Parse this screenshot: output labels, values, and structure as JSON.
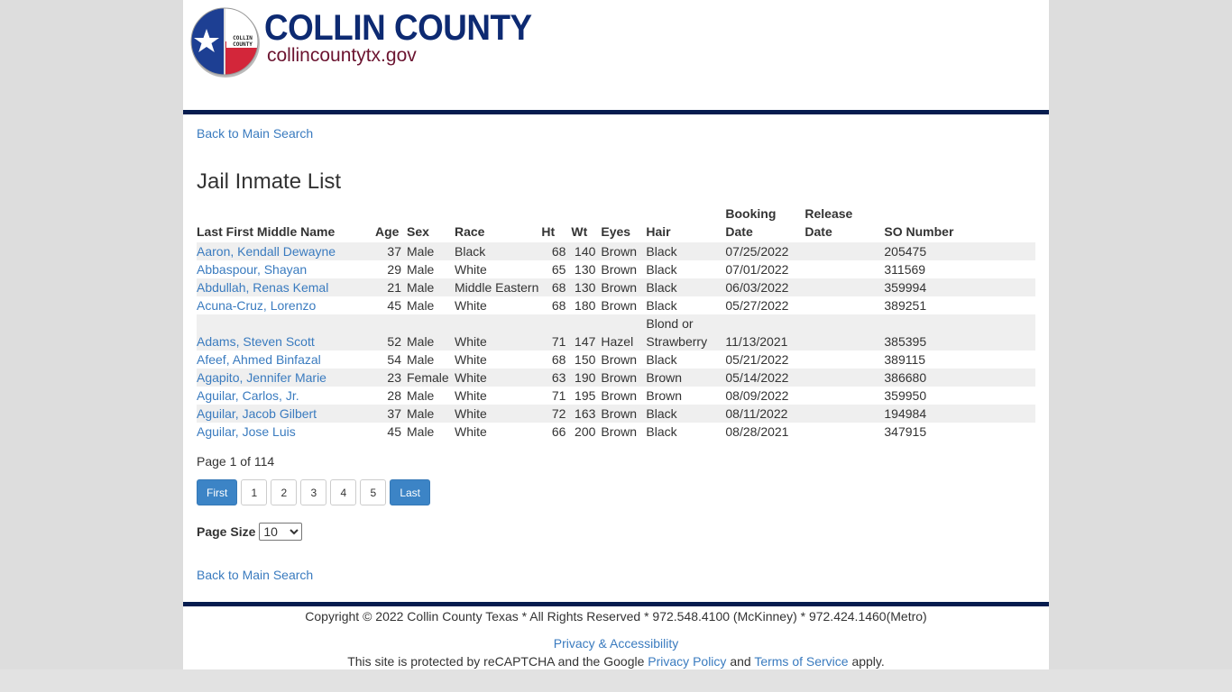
{
  "header": {
    "logo_seal_text": [
      "COLLIN",
      "COUNTY"
    ],
    "logo_title": "COLLIN COUNTY",
    "logo_subtitle": "collincountytx.gov"
  },
  "nav": {
    "back_top": "Back to Main Search",
    "back_bottom": "Back to Main Search"
  },
  "page_title": "Jail Inmate List",
  "table": {
    "columns": [
      {
        "key": "name",
        "label_line1": "",
        "label_line2": "Last First Middle Name"
      },
      {
        "key": "age",
        "label_line1": "",
        "label_line2": "Age"
      },
      {
        "key": "sex",
        "label_line1": "",
        "label_line2": "Sex"
      },
      {
        "key": "race",
        "label_line1": "",
        "label_line2": "Race"
      },
      {
        "key": "ht",
        "label_line1": "",
        "label_line2": "Ht"
      },
      {
        "key": "wt",
        "label_line1": "",
        "label_line2": "Wt"
      },
      {
        "key": "eyes",
        "label_line1": "",
        "label_line2": "Eyes"
      },
      {
        "key": "hair",
        "label_line1": "",
        "label_line2": "Hair"
      },
      {
        "key": "booking",
        "label_line1": "Booking",
        "label_line2": "Date"
      },
      {
        "key": "release",
        "label_line1": "Release",
        "label_line2": "Date"
      },
      {
        "key": "so",
        "label_line1": "",
        "label_line2": "SO Number"
      }
    ],
    "rows": [
      {
        "name": "Aaron, Kendall Dewayne",
        "age": "37",
        "sex": "Male",
        "race": "Black",
        "ht": "68",
        "wt": "140",
        "eyes": "Brown",
        "hair": "Black",
        "booking": "07/25/2022",
        "release": "",
        "so": "205475"
      },
      {
        "name": "Abbaspour, Shayan",
        "age": "29",
        "sex": "Male",
        "race": "White",
        "ht": "65",
        "wt": "130",
        "eyes": "Brown",
        "hair": "Black",
        "booking": "07/01/2022",
        "release": "",
        "so": "311569"
      },
      {
        "name": "Abdullah, Renas Kemal",
        "age": "21",
        "sex": "Male",
        "race": "Middle Eastern",
        "ht": "68",
        "wt": "130",
        "eyes": "Brown",
        "hair": "Black",
        "booking": "06/03/2022",
        "release": "",
        "so": "359994"
      },
      {
        "name": "Acuna-Cruz, Lorenzo",
        "age": "45",
        "sex": "Male",
        "race": "White",
        "ht": "68",
        "wt": "180",
        "eyes": "Brown",
        "hair": "Black",
        "booking": "05/27/2022",
        "release": "",
        "so": "389251"
      },
      {
        "name": "Adams, Steven Scott",
        "age": "52",
        "sex": "Male",
        "race": "White",
        "ht": "71",
        "wt": "147",
        "eyes": "Hazel",
        "hair": "Blond or Strawberry",
        "booking": "11/13/2021",
        "release": "",
        "so": "385395"
      },
      {
        "name": "Afeef, Ahmed Binfazal",
        "age": "54",
        "sex": "Male",
        "race": "White",
        "ht": "68",
        "wt": "150",
        "eyes": "Brown",
        "hair": "Black",
        "booking": "05/21/2022",
        "release": "",
        "so": "389115"
      },
      {
        "name": "Agapito, Jennifer Marie",
        "age": "23",
        "sex": "Female",
        "race": "White",
        "ht": "63",
        "wt": "190",
        "eyes": "Brown",
        "hair": "Brown",
        "booking": "05/14/2022",
        "release": "",
        "so": "386680"
      },
      {
        "name": "Aguilar, Carlos, Jr.",
        "age": "28",
        "sex": "Male",
        "race": "White",
        "ht": "71",
        "wt": "195",
        "eyes": "Brown",
        "hair": "Brown",
        "booking": "08/09/2022",
        "release": "",
        "so": "359950"
      },
      {
        "name": "Aguilar, Jacob Gilbert",
        "age": "37",
        "sex": "Male",
        "race": "White",
        "ht": "72",
        "wt": "163",
        "eyes": "Brown",
        "hair": "Black",
        "booking": "08/11/2022",
        "release": "",
        "so": "194984"
      },
      {
        "name": "Aguilar, Jose Luis",
        "age": "45",
        "sex": "Male",
        "race": "White",
        "ht": "66",
        "wt": "200",
        "eyes": "Brown",
        "hair": "Black",
        "booking": "08/28/2021",
        "release": "",
        "so": "347915"
      }
    ]
  },
  "pager": {
    "info": "Page 1 of 114",
    "first_label": "First",
    "last_label": "Last",
    "pages": [
      "1",
      "2",
      "3",
      "4",
      "5"
    ],
    "page_size_label": "Page Size",
    "page_size_value": "10"
  },
  "footer": {
    "copyright": "Copyright © 2022 Collin County Texas * All Rights Reserved * 972.548.4100 (McKinney) * 972.424.1460(Metro)",
    "privacy_link": "Privacy & Accessibility",
    "recaptcha_prefix": "This site is protected by reCAPTCHA and the Google",
    "privacy_policy_link": "Privacy Policy",
    "recaptcha_and": "and",
    "terms_link": "Terms of Service",
    "recaptcha_suffix": "apply."
  },
  "colors": {
    "brand_navy": "#061c4f",
    "logo_blue": "#0d2a72",
    "logo_maroon": "#6b1430",
    "link": "#3a7bbf",
    "button_primary": "#3c84c6",
    "row_stripe": "#efefef"
  }
}
